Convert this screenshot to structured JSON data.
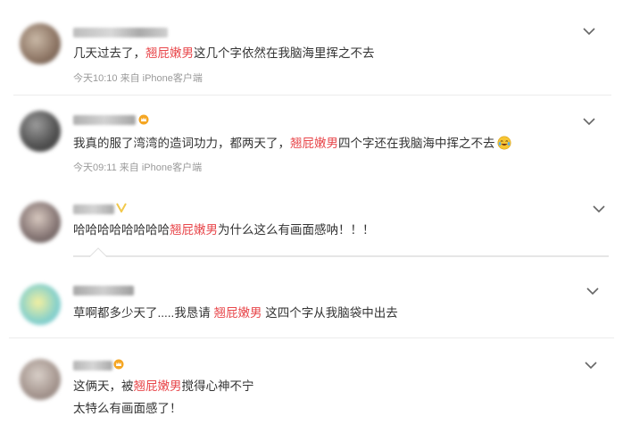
{
  "comments": [
    {
      "text_before": "几天过去了，",
      "highlight": "翘屁嫩男",
      "text_after": "这几个字依然在我脑海里挥之不去",
      "time": "今天10:10",
      "source": "来自 iPhone客户端"
    },
    {
      "text_before": "我真的服了湾湾的造词功力，都两天了，",
      "highlight": "翘屁嫩男",
      "text_after": "四个字还在我脑海中挥之不去",
      "time": "今天09:11",
      "source": "来自 iPhone客户端",
      "emoji": "laughing-tears-emoji"
    },
    {
      "text_before": "哈哈哈哈哈哈哈哈",
      "highlight": "翘屁嫩男",
      "text_after": "为什么这么有画面感呐！！！"
    },
    {
      "text_before": "草啊都多少天了.....我恳请 ",
      "highlight": "翘屁嫩男",
      "text_after": " 这四个字从我脑袋中出去"
    },
    {
      "text_before": "这俩天，被",
      "highlight": "翘屁嫩男",
      "text_after": "搅得心神不宁",
      "line2": "太特么有画面感了！"
    }
  ],
  "colors": {
    "highlight": "#e8474b",
    "meta": "#9a9a9a",
    "chevron": "#666666"
  }
}
